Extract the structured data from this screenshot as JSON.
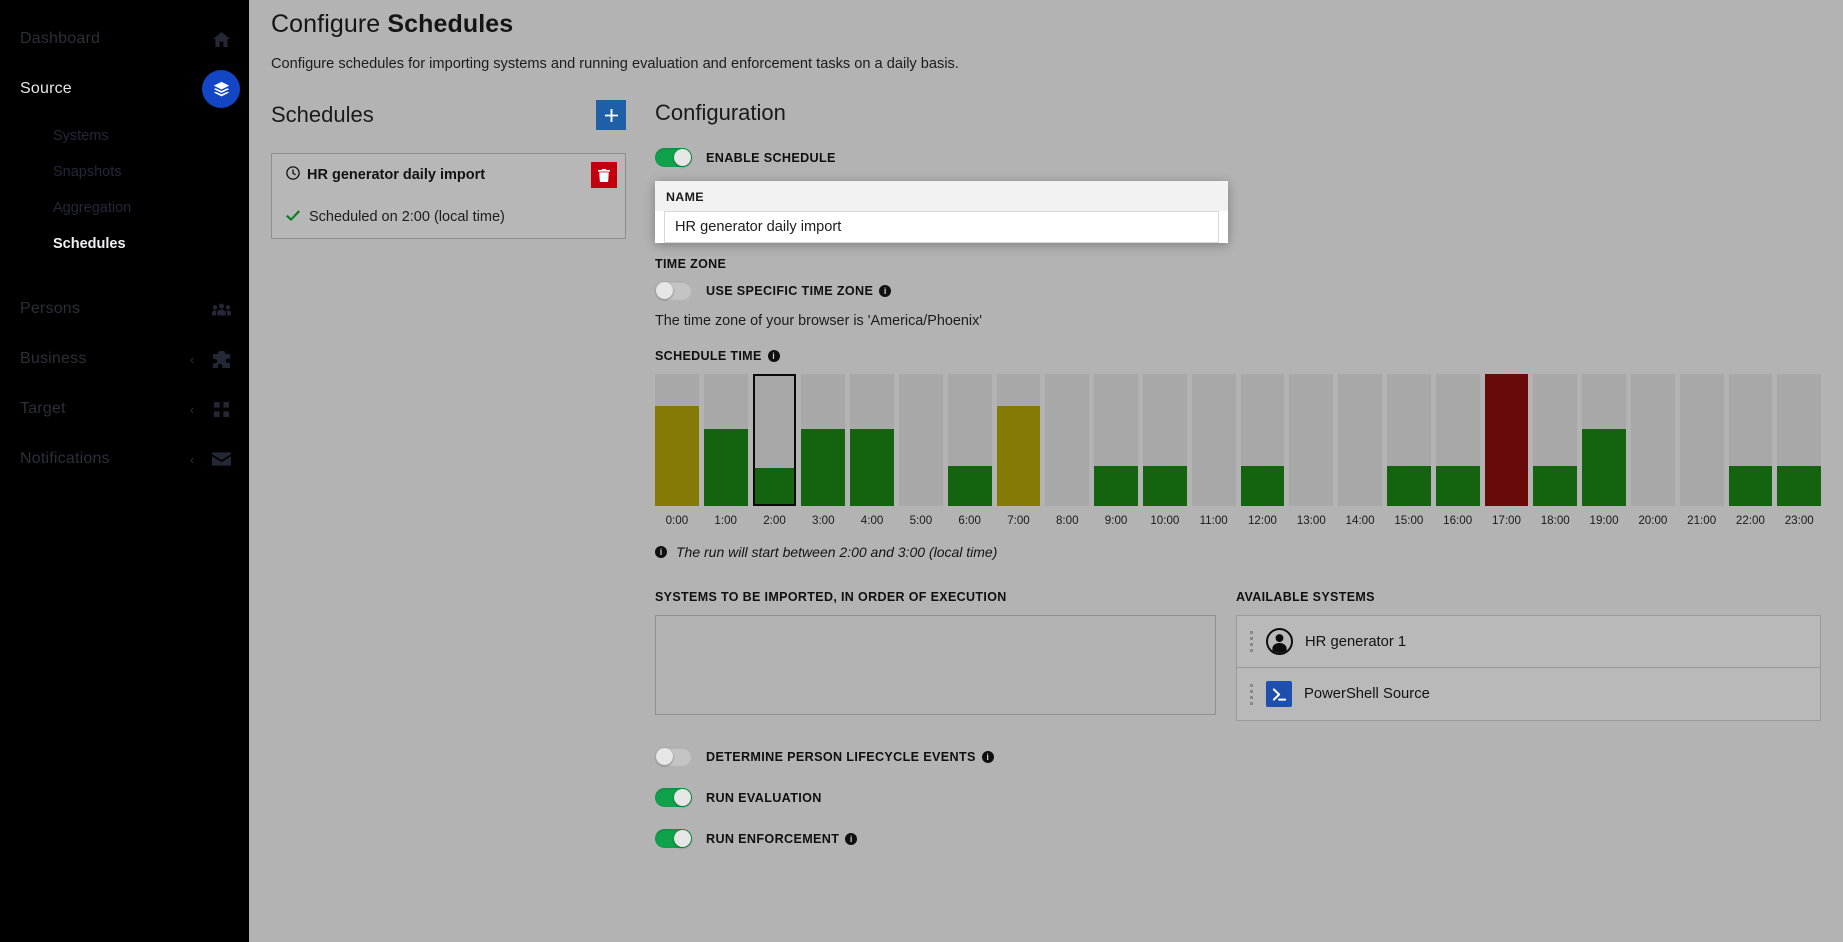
{
  "sidebar": {
    "items": [
      {
        "label": "Dashboard",
        "icon": "home-icon",
        "active": false,
        "chevron": "",
        "badge": false
      },
      {
        "label": "Source",
        "icon": "layers-icon",
        "active": true,
        "chevron": "∨",
        "badge": true
      },
      {
        "label": "Persons",
        "icon": "people-icon",
        "active": false,
        "chevron": "",
        "badge": false
      },
      {
        "label": "Business",
        "icon": "puzzle-icon",
        "active": false,
        "chevron": "‹",
        "badge": false
      },
      {
        "label": "Target",
        "icon": "grid-icon",
        "active": false,
        "chevron": "‹",
        "badge": false
      },
      {
        "label": "Notifications",
        "icon": "envelope-icon",
        "active": false,
        "chevron": "‹",
        "badge": false
      }
    ],
    "source_subitems": [
      {
        "label": "Systems",
        "active": false
      },
      {
        "label": "Snapshots",
        "active": false
      },
      {
        "label": "Aggregation",
        "active": false
      },
      {
        "label": "Schedules",
        "active": true
      }
    ]
  },
  "header": {
    "title_prefix": "Configure ",
    "title_strong": "Schedules",
    "subtitle": "Configure schedules for importing systems and running evaluation and enforcement tasks on a daily basis."
  },
  "schedules_panel": {
    "heading": "Schedules",
    "add_label": "+",
    "items": [
      {
        "name": "HR generator daily import",
        "status": "Scheduled on 2:00 (local time)",
        "delete_label": "🗑",
        "clock_icon": "clock-icon",
        "check_icon": "check-icon"
      }
    ]
  },
  "configuration": {
    "heading": "Configuration",
    "enable_schedule": {
      "label": "ENABLE SCHEDULE",
      "on": true
    },
    "name_field": {
      "label": "NAME",
      "value": "HR generator daily import",
      "placeholder": "Name"
    },
    "time_zone": {
      "label": "TIME ZONE",
      "use_specific": {
        "label": "USE SPECIFIC TIME ZONE",
        "on": false,
        "has_info": true
      },
      "browser_note": "The time zone of your browser is 'America/Phoenix'"
    },
    "schedule_time": {
      "label": "SCHEDULE TIME",
      "has_info": true,
      "run_note": "The run will start between 2:00 and 3:00 (local time)"
    },
    "systems_to_import": {
      "label": "SYSTEMS TO BE IMPORTED, IN ORDER OF EXECUTION",
      "items": []
    },
    "available_systems": {
      "label": "AVAILABLE SYSTEMS",
      "items": [
        {
          "name": "HR generator 1",
          "icon": "person-avatar-icon"
        },
        {
          "name": "PowerShell Source",
          "icon": "powershell-icon"
        }
      ]
    },
    "bottom_toggles": [
      {
        "label": "DETERMINE PERSON LIFECYCLE EVENTS",
        "on": false,
        "has_info": true
      },
      {
        "label": "RUN EVALUATION",
        "on": true,
        "has_info": false
      },
      {
        "label": "RUN ENFORCEMENT",
        "on": true,
        "has_info": true
      }
    ]
  },
  "colors": {
    "accent_blue": "#1f5fa8",
    "toggle_on": "#0fa24a",
    "delete_red": "#c2000e",
    "bar_track": "#a8a8a8",
    "bar_green": "#13630f",
    "bar_olive": "#857a06",
    "bar_darkred": "#680a09",
    "selected_outline": "#0a0a0a",
    "sidebar_bg": "#000000",
    "page_bg": "#b3b3b3"
  },
  "chart_data": {
    "type": "bar",
    "title": "SCHEDULE TIME",
    "xlabel": "",
    "ylabel": "",
    "ylim": [
      0,
      100
    ],
    "grid": false,
    "legend": "none",
    "selected_category": "2:00",
    "categories": [
      "0:00",
      "1:00",
      "2:00",
      "3:00",
      "4:00",
      "5:00",
      "6:00",
      "7:00",
      "8:00",
      "9:00",
      "10:00",
      "11:00",
      "12:00",
      "13:00",
      "14:00",
      "15:00",
      "16:00",
      "17:00",
      "18:00",
      "19:00",
      "20:00",
      "21:00",
      "22:00",
      "23:00"
    ],
    "values": [
      76,
      58,
      28,
      58,
      58,
      0,
      30,
      76,
      0,
      30,
      30,
      0,
      30,
      0,
      0,
      30,
      30,
      100,
      30,
      58,
      0,
      0,
      30,
      30
    ],
    "bar_colors": [
      "#857a06",
      "#13630f",
      "#13630f",
      "#13630f",
      "#13630f",
      "#a8a8a8",
      "#13630f",
      "#857a06",
      "#a8a8a8",
      "#13630f",
      "#13630f",
      "#a8a8a8",
      "#13630f",
      "#a8a8a8",
      "#a8a8a8",
      "#13630f",
      "#13630f",
      "#680a09",
      "#13630f",
      "#13630f",
      "#a8a8a8",
      "#a8a8a8",
      "#13630f",
      "#13630f"
    ]
  }
}
